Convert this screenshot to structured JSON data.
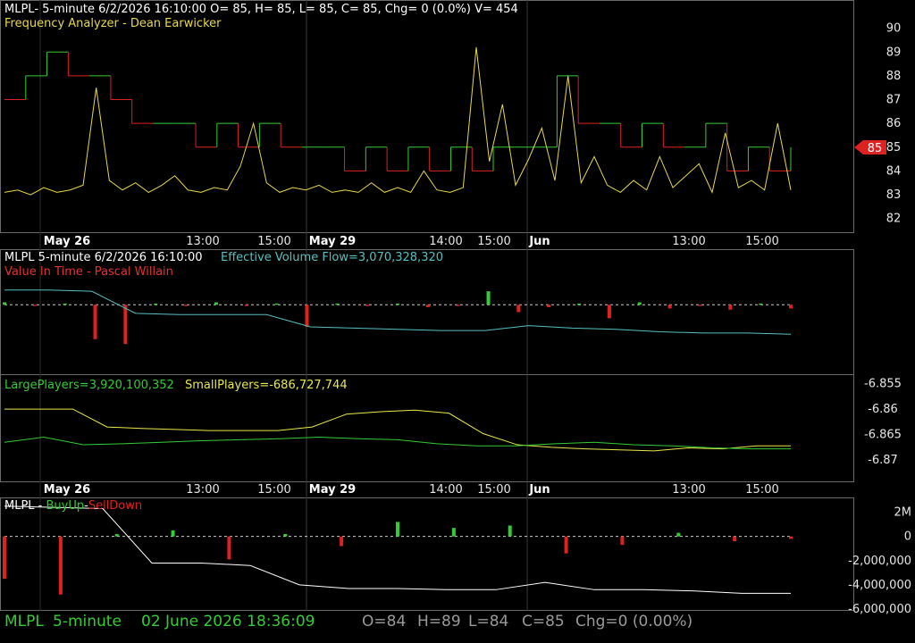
{
  "panel1": {
    "header": "MLPL- 5-minute 6/2/2026 16:10:00 O= 85, H= 85, L= 85, C= 85, Chg= 0 (0.0%) V= 454",
    "study": "Frequency Analyzer - Dean Earwicker",
    "price_tag": "85"
  },
  "panel2": {
    "header": "MLPL 5-minute  6/2/2026 16:10:00",
    "study": "Effective Volume Flow=3,070,328,320",
    "study2": "Value In Time - Pascal Willain"
  },
  "panel3": {
    "large": "LargePlayers=3,920,100,352",
    "small": "SmallPlayers=-686,727,744"
  },
  "panel4": {
    "prefix": "MLPL - ",
    "buy": "BuyUp",
    "dash": "-",
    "sell": "SellDown"
  },
  "date_axis": [
    {
      "label": "May 26",
      "bold": true
    },
    {
      "label": "13:00",
      "bold": false
    },
    {
      "label": "15:00",
      "bold": false
    },
    {
      "label": "May 29",
      "bold": true
    },
    {
      "label": "14:00",
      "bold": false
    },
    {
      "label": "15:00",
      "bold": false
    },
    {
      "label": "Jun",
      "bold": true
    },
    {
      "label": "13:00",
      "bold": false
    },
    {
      "label": "15:00",
      "bold": false
    }
  ],
  "status": {
    "symbol": "MLPL",
    "interval": "5-minute",
    "datetime": "02 June 2026 18:36:09",
    "open": "O=84",
    "high": "H=89",
    "low": "L=84",
    "close": "C=85",
    "chg": "Chg=0 (0.00%)"
  },
  "colors": {
    "up": "#33cc33",
    "down": "#dd2222",
    "oscillator": "#e8d84a",
    "flow": "#55c0c0",
    "small": "#e8e84a",
    "large": "#33cc33",
    "cum": "#ffffff",
    "status": "#33cc33"
  },
  "chart_data": [
    {
      "type": "line",
      "name": "price-panel",
      "ylim": [
        81.5,
        91
      ],
      "yticks": [
        82,
        83,
        84,
        85,
        86,
        87,
        88,
        89,
        90
      ],
      "step_y": [
        87,
        88,
        89,
        88,
        88,
        87,
        86,
        86,
        86,
        85,
        86,
        85,
        86,
        85,
        85,
        85,
        84,
        85,
        84,
        85,
        84,
        85,
        84,
        85,
        85,
        85,
        88,
        86,
        86,
        85,
        86,
        85,
        85,
        86,
        84,
        85,
        84,
        85
      ],
      "osc_y": [
        83.1,
        83.2,
        83,
        83.3,
        83.1,
        83.2,
        83.4,
        87.5,
        83.6,
        83.2,
        83.5,
        83.1,
        83.4,
        83.8,
        83.2,
        83.1,
        83.3,
        83.2,
        84.2,
        86,
        83.5,
        83.1,
        83.3,
        83.2,
        83.4,
        83.1,
        83.2,
        83.1,
        83.5,
        83.1,
        83.3,
        83.1,
        84,
        83.2,
        83.1,
        83.3,
        89.2,
        84.4,
        86.8,
        83.4,
        84.5,
        85.8,
        83.6,
        88,
        83.5,
        84.6,
        83.4,
        83.1,
        83.6,
        83.2,
        84.6,
        83.3,
        83.8,
        84.3,
        83.1,
        85.6,
        83.3,
        83.6,
        83.2,
        86,
        83.2
      ]
    },
    {
      "type": "bar",
      "name": "effective-volume-flow",
      "ylim": [
        -5,
        3
      ],
      "bars": [
        0.2,
        -0.1,
        0.1,
        -2.8,
        -3.2,
        0.1,
        -0.1,
        0.2,
        -0.1,
        0.1,
        -1.8,
        0.1,
        -0.1,
        0.1,
        -0.2,
        -0.1,
        1.1,
        -0.6,
        -0.2,
        0.1,
        -1.1,
        0.2,
        -0.3,
        -0.1,
        -0.4,
        0.1,
        -0.3
      ],
      "flow": [
        1.2,
        1.2,
        1.1,
        -0.7,
        -0.8,
        -0.8,
        -0.8,
        -1.8,
        -1.9,
        -2.0,
        -2.1,
        -2.1,
        -1.7,
        -1.9,
        -2.0,
        -2.2,
        -2.3,
        -2.3,
        -2.4
      ]
    },
    {
      "type": "line",
      "name": "players-panel",
      "ylim": [
        -6.874,
        -6.8535
      ],
      "yticks": [
        -6.855,
        -6.86,
        -6.865,
        -6.87
      ],
      "series": [
        {
          "name": "SmallPlayers",
          "values": [
            -6.86,
            -6.86,
            -6.86,
            -6.8635,
            -6.8638,
            -6.864,
            -6.8642,
            -6.8642,
            -6.8642,
            -6.8635,
            -6.861,
            -6.8605,
            -6.8602,
            -6.8608,
            -6.8648,
            -6.867,
            -6.8675,
            -6.8678,
            -6.868,
            -6.8682,
            -6.8676,
            -6.8678,
            -6.8672,
            -6.8672
          ]
        },
        {
          "name": "LargePlayers",
          "values": [
            -6.8665,
            -6.8655,
            -6.867,
            -6.8668,
            -6.8665,
            -6.8662,
            -6.866,
            -6.8658,
            -6.8655,
            -6.8658,
            -6.866,
            -6.8668,
            -6.8672,
            -6.8672,
            -6.8668,
            -6.8665,
            -6.867,
            -6.8672,
            -6.8676,
            -6.8678,
            -6.8678
          ]
        }
      ]
    },
    {
      "type": "bar",
      "name": "buyup-selldown",
      "ylim": [
        -6000000,
        3000000
      ],
      "yticks": [
        -6000000,
        -4000000,
        -2000000,
        0,
        2000000
      ],
      "ytick_labels": [
        "-6,000,000",
        "-4,000,000",
        "-2,000,000",
        "0",
        "2M"
      ],
      "bars": [
        -3500000,
        -4800000,
        200000,
        500000,
        -1900000,
        200000,
        -800000,
        1200000,
        700000,
        900000,
        -1400000,
        -700000,
        300000,
        -400000,
        -200000
      ],
      "cumulative": [
        2500000,
        2400000,
        2300000,
        -2200000,
        -2200000,
        -2400000,
        -4000000,
        -4300000,
        -4300000,
        -4400000,
        -4400000,
        -3800000,
        -4400000,
        -4400000,
        -4500000,
        -4700000,
        -4700000
      ]
    }
  ]
}
